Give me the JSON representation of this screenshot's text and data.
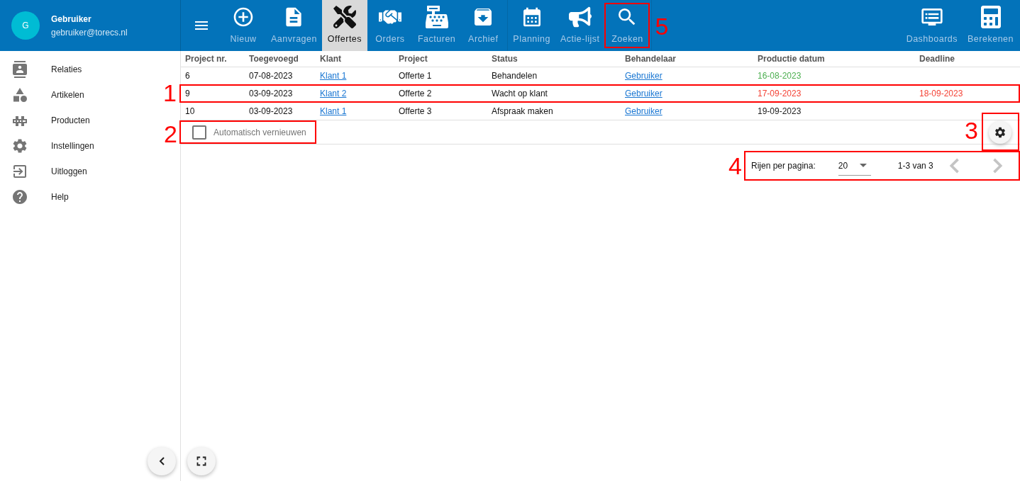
{
  "user": {
    "initial": "G",
    "name": "Gebruiker",
    "email": "gebruiker@torecs.nl"
  },
  "toolbar_groups": [
    [
      {
        "label": "Nieuw",
        "selected": false
      },
      {
        "label": "Aanvragen",
        "selected": false
      },
      {
        "label": "Offertes",
        "selected": true
      },
      {
        "label": "Orders",
        "selected": false
      },
      {
        "label": "Facturen",
        "selected": false
      },
      {
        "label": "Archief",
        "selected": false
      }
    ],
    [
      {
        "label": "Planning",
        "selected": false
      },
      {
        "label": "Actie-lijst",
        "selected": false
      },
      {
        "label": "Zoeken",
        "selected": false,
        "annotation": "5"
      }
    ]
  ],
  "right_toolbar": [
    {
      "label": "Dashboards",
      "selected": false
    },
    {
      "label": "Berekenen",
      "selected": false
    }
  ],
  "sidebar": {
    "items": [
      {
        "label": "Relaties"
      },
      {
        "label": "Artikelen"
      },
      {
        "label": "Producten"
      },
      {
        "label": "Instellingen"
      },
      {
        "label": "Uitloggen"
      },
      {
        "label": "Help"
      }
    ]
  },
  "table": {
    "columns": [
      "Project nr.",
      "Toegevoegd",
      "Klant",
      "Project",
      "Status",
      "Behandelaar",
      "Productie datum",
      "Deadline"
    ],
    "rows": [
      {
        "project_nr": "6",
        "toegevoegd": "07-08-2023",
        "klant": "Klant 1",
        "project": "Offerte 1",
        "status": "Behandelen",
        "behandelaar": "Gebruiker",
        "productie_datum": {
          "text": "16-08-2023",
          "color": "#4caf50"
        }
      },
      {
        "project_nr": "9",
        "toegevoegd": "03-09-2023",
        "klant": "Klant 2",
        "project": "Offerte 2",
        "status": "Wacht op klant",
        "behandelaar": "Gebruiker",
        "productie_datum": {
          "text": "17-09-2023",
          "color": "#f44336"
        },
        "deadline": {
          "text": "18-09-2023",
          "color": "#f44336"
        },
        "annotation": "1"
      },
      {
        "project_nr": "10",
        "toegevoegd": "03-09-2023",
        "klant": "Klant 1",
        "project": "Offerte 3",
        "status": "Afspraak maken",
        "behandelaar": "Gebruiker",
        "productie_datum": {
          "text": "19-09-2023",
          "color": "#212121"
        }
      }
    ]
  },
  "auto_refresh": {
    "label": "Automatisch vernieuwen",
    "checked": false,
    "annotation": "2"
  },
  "settings_button": {
    "annotation": "3"
  },
  "pagination": {
    "rows_label": "Rijen per pagina:",
    "rows_value": "20",
    "range": "1-3 van 3",
    "prev_disabled": true,
    "next_disabled": true,
    "annotation": "4"
  }
}
